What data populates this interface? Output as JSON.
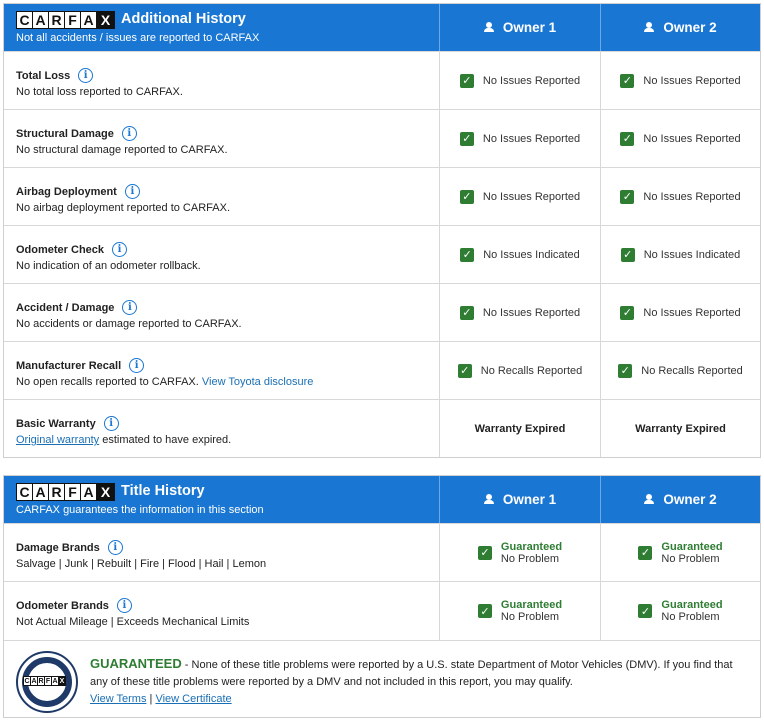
{
  "logo": {
    "letters": [
      "C",
      "A",
      "R",
      "F",
      "A",
      "X"
    ]
  },
  "owners": [
    "Owner 1",
    "Owner 2"
  ],
  "additional": {
    "title": "Additional History",
    "subtitle": "Not all accidents / issues are reported to CARFAX",
    "rows": [
      {
        "title": "Total Loss",
        "desc": "No total loss reported to CARFAX.",
        "o1": "No Issues Reported",
        "o2": "No Issues Reported"
      },
      {
        "title": "Structural Damage",
        "desc": "No structural damage reported to CARFAX.",
        "o1": "No Issues Reported",
        "o2": "No Issues Reported"
      },
      {
        "title": "Airbag Deployment",
        "desc": "No airbag deployment reported to CARFAX.",
        "o1": "No Issues Reported",
        "o2": "No Issues Reported"
      },
      {
        "title": "Odometer Check",
        "desc": "No indication of an odometer rollback.",
        "o1": "No Issues Indicated",
        "o2": "No Issues Indicated"
      },
      {
        "title": "Accident / Damage",
        "desc": "No accidents or damage reported to CARFAX.",
        "o1": "No Issues Reported",
        "o2": "No Issues Reported"
      },
      {
        "title": "Manufacturer Recall",
        "desc": "No open recalls reported to CARFAX.",
        "desc_link": "View Toyota disclosure",
        "o1": "No Recalls Reported",
        "o2": "No Recalls Reported"
      },
      {
        "title": "Basic Warranty",
        "desc_link_lead": "Original warranty",
        "desc": "estimated to have expired.",
        "o1": "Warranty Expired",
        "o2": "Warranty Expired"
      }
    ]
  },
  "title_history": {
    "title": "Title History",
    "subtitle": "CARFAX guarantees the information in this section",
    "rows": [
      {
        "title": "Damage Brands",
        "desc": "Salvage | Junk | Rebuilt | Fire | Flood | Hail | Lemon",
        "line1": "Guaranteed",
        "line2": "No Problem"
      },
      {
        "title": "Odometer Brands",
        "desc": "Not Actual Mileage | Exceeds Mechanical Limits",
        "line1": "Guaranteed",
        "line2": "No Problem"
      }
    ],
    "footer": {
      "guaranteed": "GUARANTEED",
      "text": " - None of these title problems were reported by a U.S. state Department of Motor Vehicles (DMV). If you find that any of these title problems were reported by a DMV and not included in this report, you may qualify.",
      "link1": "View Terms",
      "sep": " | ",
      "link2": "View Certificate"
    }
  },
  "colors": {
    "header_blue": "#1976d2",
    "check_green": "#2e7d32",
    "link_blue": "#1a6fb5"
  }
}
